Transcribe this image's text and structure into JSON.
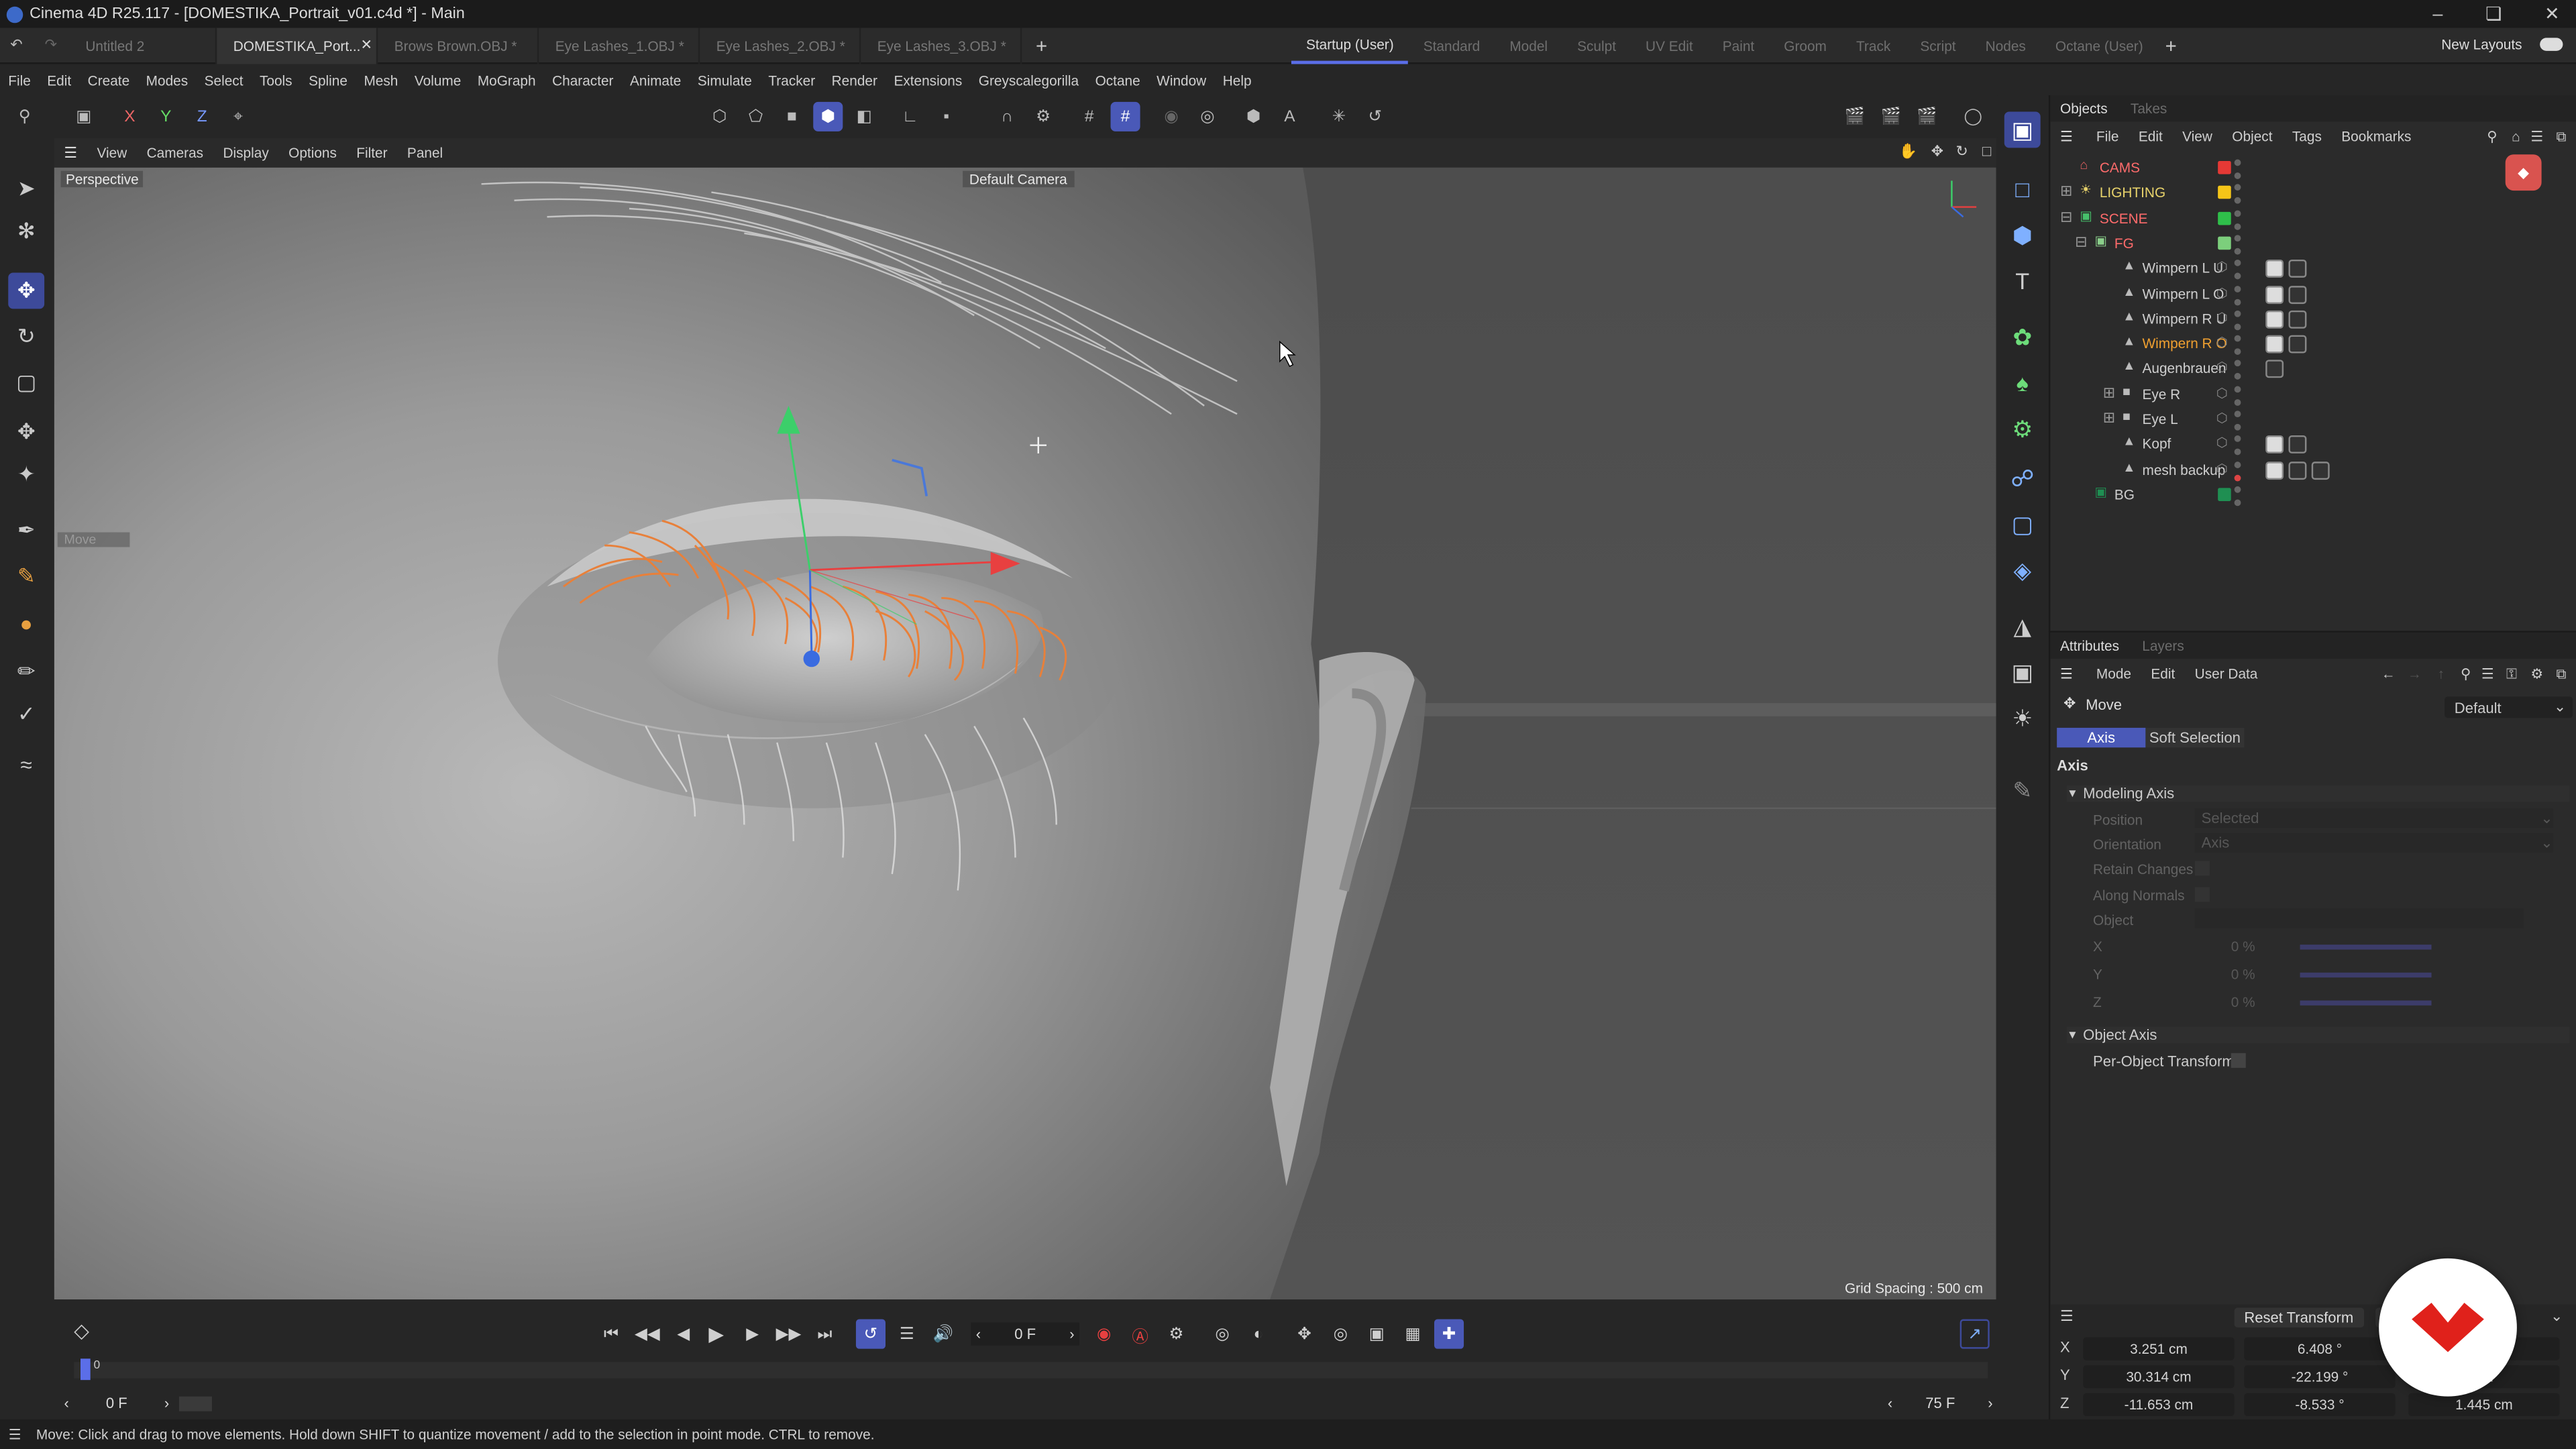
{
  "window": {
    "title": "Cinema 4D R25.117 - [DOMESTIKA_Portrait_v01.c4d *] - Main"
  },
  "doc_tabs": [
    {
      "label": "Untitled 2"
    },
    {
      "label": "DOMESTIKA_Port..."
    },
    {
      "label": "Brows Brown.OBJ *"
    },
    {
      "label": "Eye Lashes_1.OBJ *"
    },
    {
      "label": "Eye Lashes_2.OBJ *"
    },
    {
      "label": "Eye Lashes_3.OBJ *"
    }
  ],
  "layouts": [
    "Startup (User)",
    "Standard",
    "Model",
    "Sculpt",
    "UV Edit",
    "Paint",
    "Groom",
    "Track",
    "Script",
    "Nodes",
    "Octane (User)"
  ],
  "new_layouts": "New Layouts",
  "menus": [
    "File",
    "Edit",
    "Create",
    "Modes",
    "Select",
    "Tools",
    "Spline",
    "Mesh",
    "Volume",
    "MoGraph",
    "Character",
    "Animate",
    "Simulate",
    "Tracker",
    "Render",
    "Extensions",
    "Greyscalegorilla",
    "Octane",
    "Window",
    "Help"
  ],
  "axis_buttons": {
    "x": "X",
    "y": "Y",
    "z": "Z"
  },
  "viewport": {
    "menus": [
      "View",
      "Cameras",
      "Display",
      "Options",
      "Filter",
      "Panel"
    ],
    "projection": "Perspective",
    "camera": "Default Camera",
    "grid_spacing": "Grid Spacing : 500 cm",
    "hud_move": "Move"
  },
  "objects_panel": {
    "tabs": [
      "Objects",
      "Takes"
    ],
    "menus": [
      "File",
      "Edit",
      "View",
      "Object",
      "Tags",
      "Bookmarks"
    ],
    "items": [
      {
        "name": "CAMS",
        "color": "#e53935",
        "label_color": "#ff6b6b"
      },
      {
        "name": "LIGHTING",
        "color": "#f5c518",
        "label_color": "#e8d36b"
      },
      {
        "name": "SCENE",
        "color": "#2fbf4a",
        "label_color": "#ff6b6b"
      },
      {
        "name": "FG",
        "color": "#7ccf7c",
        "label_color": "#ff6b6b"
      },
      {
        "name": "Wimpern L U",
        "label_color": "#cfcfcf"
      },
      {
        "name": "Wimpern L O",
        "label_color": "#cfcfcf"
      },
      {
        "name": "Wimpern R U",
        "label_color": "#cfcfcf"
      },
      {
        "name": "Wimpern R O",
        "label_color": "#f0a030"
      },
      {
        "name": "Augenbrauen",
        "label_color": "#cfcfcf"
      },
      {
        "name": "Eye R",
        "label_color": "#cfcfcf"
      },
      {
        "name": "Eye L",
        "label_color": "#cfcfcf"
      },
      {
        "name": "Kopf",
        "label_color": "#cfcfcf"
      },
      {
        "name": "mesh backup",
        "label_color": "#cfcfcf"
      },
      {
        "name": "BG",
        "color": "#1f8f52",
        "label_color": "#cfcfcf"
      }
    ]
  },
  "attributes_panel": {
    "tabs": [
      "Attributes",
      "Layers"
    ],
    "menus": [
      "Mode",
      "Edit",
      "User Data"
    ],
    "tool": "Move",
    "preset": "Default",
    "subtabs": [
      "Axis",
      "Soft Selection"
    ],
    "section": "Axis",
    "groups": {
      "modeling_axis": "Modeling Axis",
      "object_axis": "Object Axis"
    },
    "fields": {
      "position_label": "Position",
      "position_value": "Selected",
      "orientation_label": "Orientation",
      "orientation_value": "Axis",
      "retain_changes": "Retain Changes",
      "along_normals": "Along Normals",
      "object": "Object",
      "x_label": "X",
      "x_value": "0 %",
      "y_label": "Y",
      "y_value": "0 %",
      "z_label": "Z",
      "z_value": "0 %",
      "per_object_transform": "Per-Object Transform"
    }
  },
  "coordinates": {
    "reset": "Reset Transform",
    "rows": [
      {
        "axis": "X",
        "pos": "3.251 cm",
        "rot": "6.408 °",
        "size": ""
      },
      {
        "axis": "Y",
        "pos": "30.314 cm",
        "rot": "-22.199 °",
        "size": "cm"
      },
      {
        "axis": "Z",
        "pos": "-11.653 cm",
        "rot": "-8.533 °",
        "size": "1.445 cm"
      }
    ]
  },
  "timeline": {
    "current_frame": "0 F",
    "start_frame": "0 F",
    "end_frame": "75 F",
    "marker": "0"
  },
  "status": "Move: Click and drag to move elements. Hold down SHIFT to quantize movement / add to the selection in point mode. CTRL to remove."
}
